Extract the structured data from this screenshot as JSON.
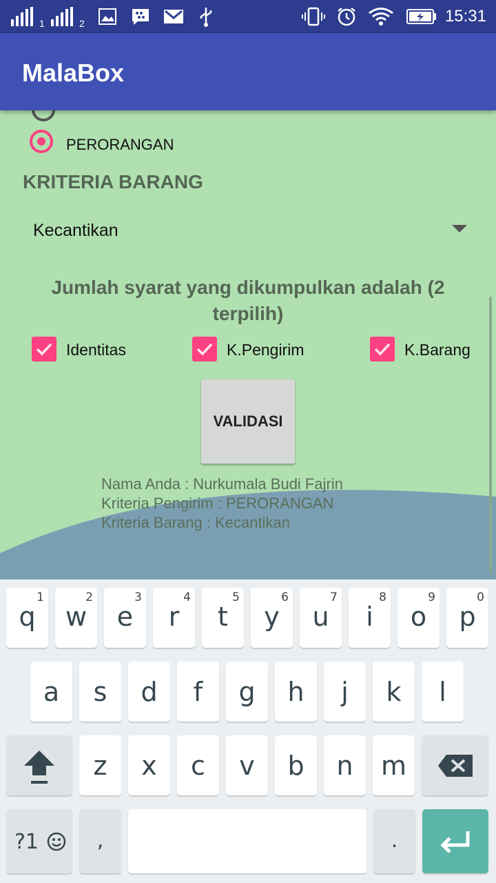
{
  "status_bar": {
    "time": "15:31",
    "sim1": "1",
    "sim2": "2",
    "icons": [
      "signal-icon",
      "signal-icon",
      "image-icon",
      "bbm-icon",
      "gmail-icon",
      "usb-icon",
      "vibrate-icon",
      "alarm-icon",
      "wifi-icon",
      "battery-icon"
    ]
  },
  "app_bar": {
    "title": "MalaBox"
  },
  "form": {
    "radio_label": "PERORANGAN",
    "section_title": "KRITERIA BARANG",
    "spinner_value": "Kecantikan",
    "question": "Jumlah syarat yang dikumpulkan adalah (2 terpilih)",
    "checkboxes": [
      {
        "label": "Identitas",
        "checked": true
      },
      {
        "label": "K.Pengirim",
        "checked": true
      },
      {
        "label": "K.Barang",
        "checked": true
      }
    ],
    "button_label": "VALIDASI",
    "results": [
      "Nama Anda : Nurkumala Budi Fajrin",
      "Kriteria Pengirim : PERORANGAN",
      "Kriteria Barang : Kecantikan"
    ],
    "colors": {
      "accent": "#ff4081",
      "primary": "#3f51b5",
      "background": "#b0e0b0",
      "wave": "#7b9fb2"
    }
  },
  "keyboard": {
    "row1": [
      {
        "ch": "q",
        "hint": "1"
      },
      {
        "ch": "w",
        "hint": "2"
      },
      {
        "ch": "e",
        "hint": "3"
      },
      {
        "ch": "r",
        "hint": "4"
      },
      {
        "ch": "t",
        "hint": "5"
      },
      {
        "ch": "y",
        "hint": "6"
      },
      {
        "ch": "u",
        "hint": "7"
      },
      {
        "ch": "i",
        "hint": "8"
      },
      {
        "ch": "o",
        "hint": "9"
      },
      {
        "ch": "p",
        "hint": "0"
      }
    ],
    "row2": [
      "a",
      "s",
      "d",
      "f",
      "g",
      "h",
      "j",
      "k",
      "l"
    ],
    "row3": [
      "z",
      "x",
      "c",
      "v",
      "b",
      "n",
      "m"
    ],
    "symbols_label": "?1",
    "comma": ",",
    "period": "."
  }
}
